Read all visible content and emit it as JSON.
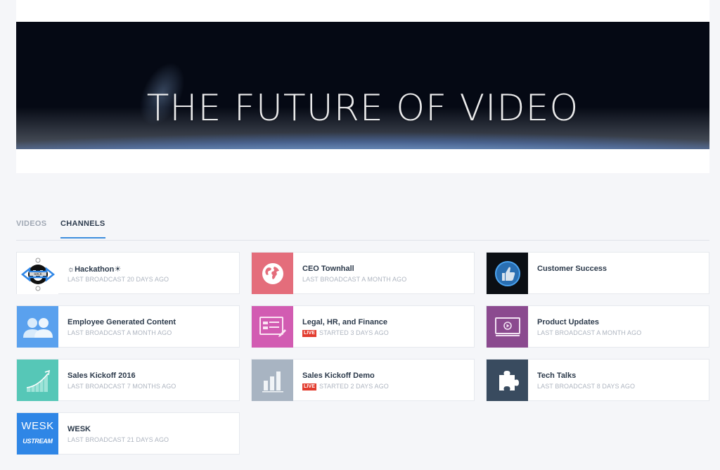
{
  "hero": {
    "title": "THE FUTURE OF VIDEO"
  },
  "tabs": [
    {
      "label": "VIDEOS",
      "active": false
    },
    {
      "label": "CHANNELS",
      "active": true
    }
  ],
  "colors": {
    "accent": "#3e8ede",
    "live_badge": "#e23b2e"
  },
  "channels": [
    {
      "title": "☼Hackathon☀",
      "subtitle": "LAST BROADCAST 20 DAYS AGO",
      "live": false,
      "thumb_color": "#ffffff",
      "icon": "hackathon-logo-icon"
    },
    {
      "title": "CEO Townhall",
      "subtitle": "LAST BROADCAST A MONTH AGO",
      "live": false,
      "thumb_color": "#e46d7b",
      "icon": "globe-icon"
    },
    {
      "title": "Customer Success",
      "subtitle": "",
      "live": false,
      "thumb_color": "#0b0f14",
      "icon": "thumbs-up-icon"
    },
    {
      "title": "Employee Generated Content",
      "subtitle": "LAST BROADCAST A MONTH AGO",
      "live": false,
      "thumb_color": "#5aa1ee",
      "icon": "users-icon"
    },
    {
      "title": "Legal, HR, and Finance",
      "subtitle": "STARTED 3 DAYS AGO",
      "live": true,
      "live_label": "LIVE",
      "thumb_color": "#d25cb2",
      "icon": "document-edit-icon"
    },
    {
      "title": "Product Updates",
      "subtitle": "LAST BROADCAST A MONTH AGO",
      "live": false,
      "thumb_color": "#8b4a8f",
      "icon": "video-screen-icon"
    },
    {
      "title": "Sales Kickoff 2016",
      "subtitle": "LAST BROADCAST 7 MONTHS AGO",
      "live": false,
      "thumb_color": "#56c7b7",
      "icon": "growth-chart-icon"
    },
    {
      "title": "Sales Kickoff Demo",
      "subtitle": "STARTED 2 DAYS AGO",
      "live": true,
      "live_label": "LIVE",
      "thumb_color": "#a8b4c2",
      "icon": "bar-chart-icon"
    },
    {
      "title": "Tech Talks",
      "subtitle": "LAST BROADCAST 8 DAYS AGO",
      "live": false,
      "thumb_color": "#394b5f",
      "icon": "puzzle-icon"
    },
    {
      "title": "WESK",
      "subtitle": "LAST BROADCAST 21 DAYS AGO",
      "live": false,
      "thumb_color": "#2f86e6",
      "icon": "wesk-ustream-logo-icon",
      "thumb_text": "WESK",
      "thumb_brand": "USTREAM"
    }
  ]
}
